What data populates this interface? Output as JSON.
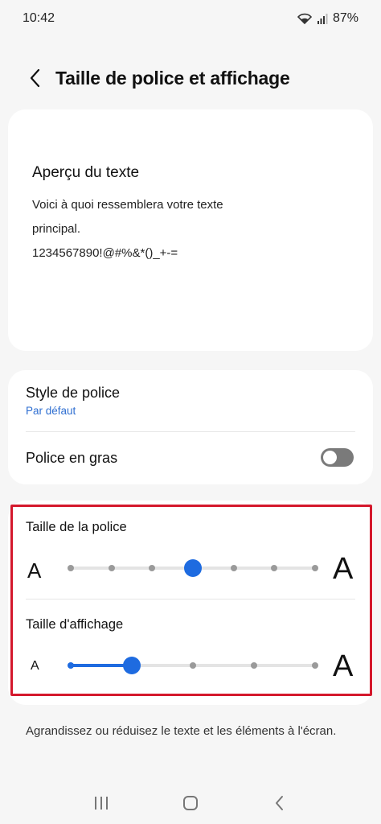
{
  "status": {
    "time": "10:42",
    "battery": "87%"
  },
  "header": {
    "title": "Taille de police et affichage"
  },
  "preview": {
    "title": "Aperçu du texte",
    "line1": "Voici à quoi ressemblera votre texte",
    "line2": "principal.",
    "line3": "1234567890!@#%&*()_+-="
  },
  "options": {
    "font_style_label": "Style de police",
    "font_style_value": "Par défaut",
    "bold_label": "Police en gras",
    "bold_enabled": false
  },
  "sizes": {
    "font_size_label": "Taille de la police",
    "font_size_small_glyph": "A",
    "font_size_large_glyph": "A",
    "font_size_steps": 7,
    "font_size_level": 4,
    "display_size_label": "Taille d'affichage",
    "display_size_small_glyph": "A",
    "display_size_large_glyph": "A",
    "display_size_steps": 5,
    "display_size_level": 2
  },
  "footnote": {
    "text": "Agrandissez ou réduisez le texte et les éléments à l'écran."
  },
  "colors": {
    "accent": "#1e6be0",
    "highlight_border": "#d4182c",
    "link": "#2f6fd1"
  }
}
